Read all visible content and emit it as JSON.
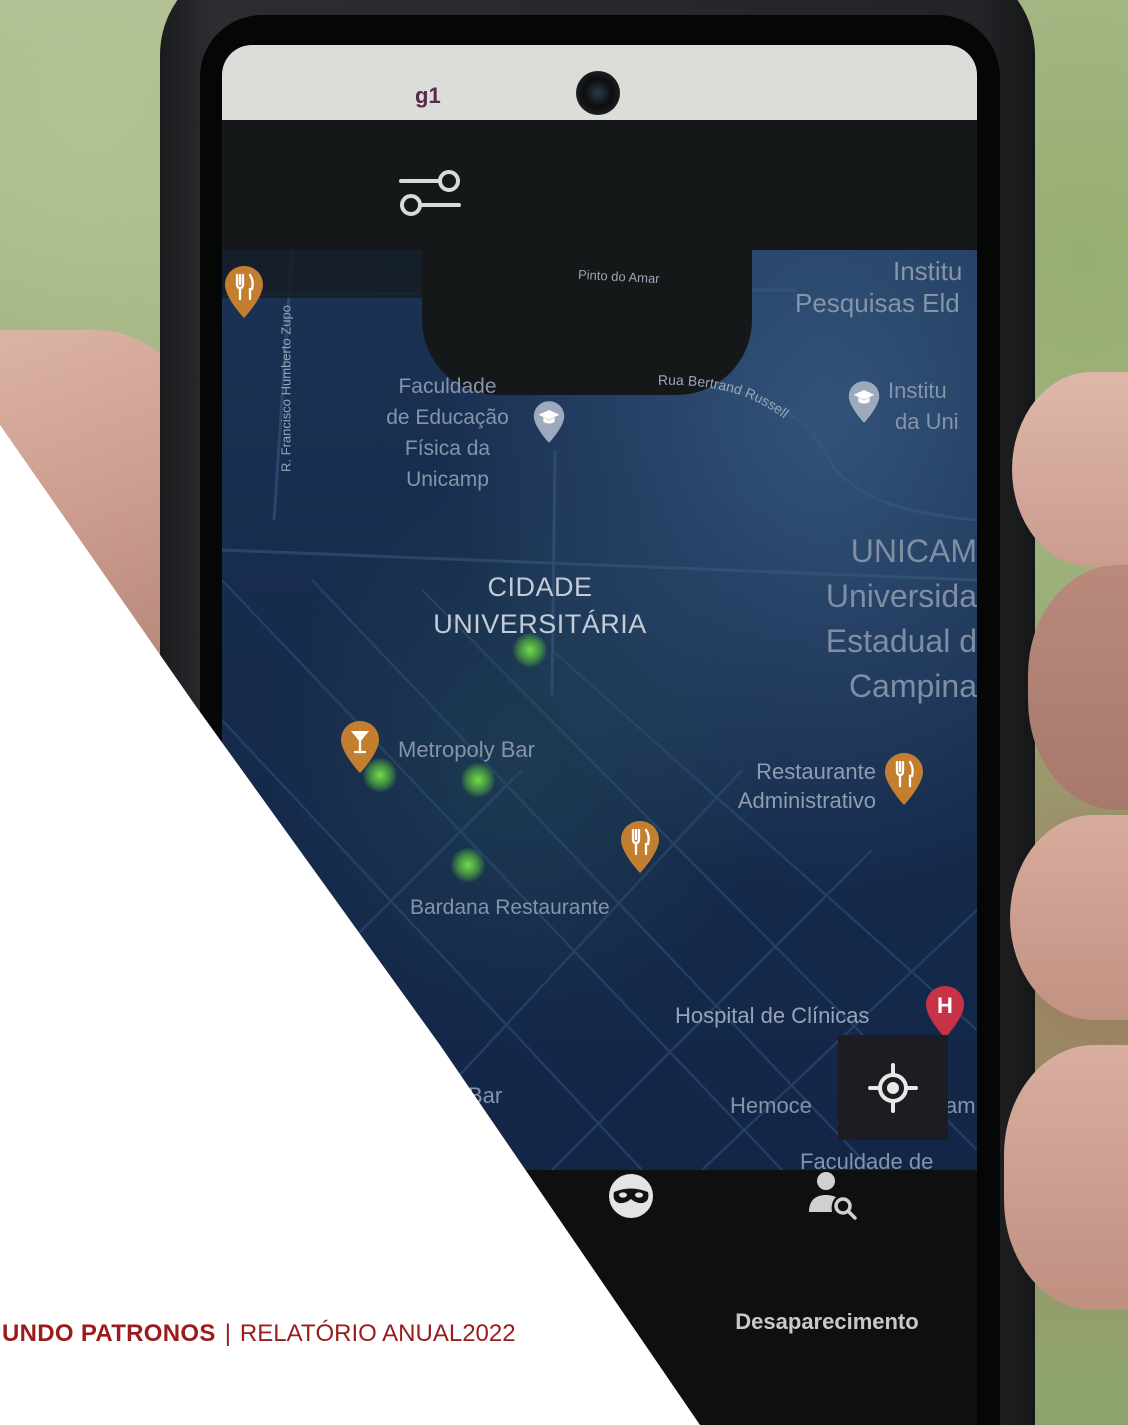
{
  "status_bar": {
    "brand_text": "g1"
  },
  "map": {
    "road_pinto": "Pinto do Amar",
    "road_francisco": "R. Francisco Humberto Zupo",
    "road_bertrand": "Rua Bertrand Russell",
    "instituto_pesquisas": [
      "Institu",
      "Pesquisas Eld"
    ],
    "faculdade_educacao": [
      "Faculdade",
      "de Educação",
      "Física da",
      "Unicamp"
    ],
    "instituto_uni": [
      "Institu",
      "da Uni"
    ],
    "district": [
      "CIDADE",
      "UNIVERSITÁRIA"
    ],
    "unicamp": [
      "UNICAM",
      "Universida",
      "Estadual d",
      "Campina"
    ],
    "metropoly": "Metropoly Bar",
    "restaurante_adm": [
      "Restaurante",
      "Administrativo"
    ],
    "bardana": "Bardana Restaurante",
    "hospital": "Hospital de Clínicas",
    "hospital_pin_letter": "H",
    "bar_partial": "Bar",
    "hemocentro_partial": [
      "Hemoce",
      "am"
    ],
    "faculdade_partial": "Faculdade de"
  },
  "nav": {
    "items": [
      {
        "icon": "mask-icon"
      },
      {
        "icon": "person-search-icon",
        "label": "Desaparecimento"
      }
    ]
  },
  "footer": {
    "org": "UNDO PATRONOS",
    "separator": "|",
    "report": "RELATÓRIO ANUAL2022"
  },
  "icons": {
    "filter": "sliders-icon",
    "locate": "crosshair-icon",
    "restaurant_pin": "fork-knife-pin-icon",
    "bar_pin": "cocktail-pin-icon",
    "school_pin": "graduation-cap-pin-icon",
    "hospital_pin": "hospital-pin-icon"
  },
  "colors": {
    "footer_text": "#9b1c1c",
    "map_background": "#162b4c",
    "restaurant_pin": "#c47e30",
    "school_pin": "#9daabd",
    "hospital_pin": "#c73246",
    "activity_dot": "#78e646",
    "status_bar": "#dcdcd8",
    "nav_background": "#0e0f10"
  }
}
